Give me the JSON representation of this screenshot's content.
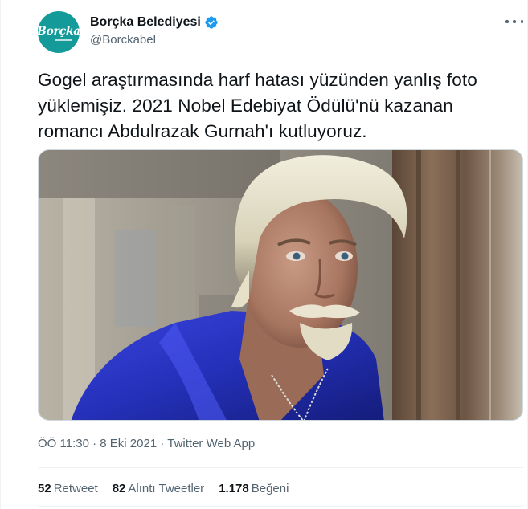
{
  "account": {
    "display_name": "Borçka Belediyesi",
    "handle": "@Borckabel",
    "avatar_text": "Borçka",
    "verified": true,
    "avatar_color": "#149a98",
    "verified_color": "#1d9bf0"
  },
  "tweet": {
    "text": "Gogel araştırmasında harf hatası yüzünden yanlış foto\nyüklemişiz. 2021 Nobel Edebiyat Ödülü'nü kazanan\nromancı Abdulrazak Gurnah'ı kutluyoruz.",
    "time": "ÖÖ 11:30",
    "date": "8 Eki 2021",
    "source": "Twitter Web App",
    "separator": "·"
  },
  "stats": {
    "retweets": {
      "count": "52",
      "label": "Retweet"
    },
    "quotes": {
      "count": "82",
      "label": "Alıntı Tweetler"
    },
    "likes": {
      "count": "1.178",
      "label": "Beğeni"
    }
  },
  "icons": {
    "more": "more-horizontal-icon",
    "verified": "verified-badge-icon"
  }
}
